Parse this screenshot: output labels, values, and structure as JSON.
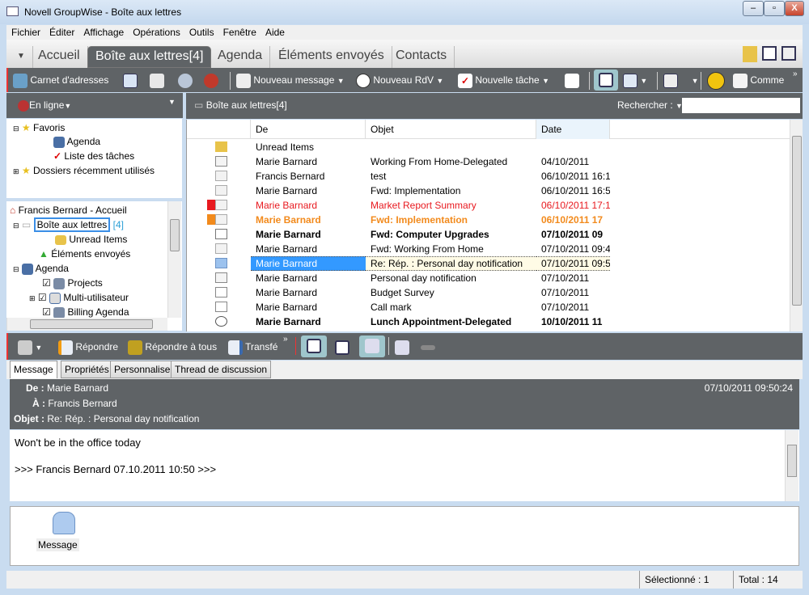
{
  "window": {
    "title": "Novell GroupWise - Boîte aux lettres",
    "minimize": "–",
    "maximize": "▫",
    "close": "X"
  },
  "menu": [
    "Fichier",
    "Éditer",
    "Affichage",
    "Opérations",
    "Outils",
    "Fenêtre",
    "Aide"
  ],
  "tabs": [
    {
      "label": "Accueil"
    },
    {
      "label": "Boîte aux lettres[4]",
      "active": true
    },
    {
      "label": "Agenda"
    },
    {
      "label": "Éléments envoyés"
    },
    {
      "label": "Contacts"
    }
  ],
  "toolbar": {
    "address_book": "Carnet d'adresses",
    "new_message": "Nouveau message",
    "new_appointment": "Nouveau RdV",
    "new_task": "Nouvelle tâche",
    "comment": "Comme",
    "overflow": "»"
  },
  "left": {
    "mode": "En ligne",
    "favorites": [
      {
        "label": "Favoris"
      },
      {
        "label": "Agenda"
      },
      {
        "label": "Liste des tâches"
      },
      {
        "label": "Dossiers récemment utilisés"
      }
    ],
    "tree": {
      "home": "Francis Bernard - Accueil",
      "mailbox": "Boîte aux lettres",
      "mailbox_count": "[4]",
      "unread": "Unread Items",
      "sent": "Éléments envoyés",
      "calendar": "Agenda",
      "projects": "Projects",
      "multi": "Multi-utilisateur",
      "billing": "Billing Agenda"
    }
  },
  "list": {
    "folder": "Boîte aux lettres[4]",
    "search_label": "Rechercher :",
    "search_value": "",
    "columns": [
      "De",
      "Objet",
      "Date"
    ],
    "rows": [
      {
        "icon": "search-folder",
        "from": "Unread Items",
        "subject": "",
        "date": "",
        "style": "normal"
      },
      {
        "icon": "note-attach",
        "from": "Marie Barnard",
        "subject": "Working From Home-Delegated",
        "date": "04/10/2011",
        "style": "normal"
      },
      {
        "icon": "envelope-open",
        "from": "Francis Bernard",
        "subject": "test",
        "date": "06/10/2011 16:1",
        "style": "normal"
      },
      {
        "icon": "envelope-open",
        "from": "Marie Barnard",
        "subject": "Fwd: Implementation",
        "date": "06/10/2011 16:5",
        "style": "normal"
      },
      {
        "icon": "envelope-red-attach",
        "from": "Marie Barnard",
        "subject": "Market Report Summary",
        "date": "06/10/2011 17:1",
        "style": "red"
      },
      {
        "icon": "envelope-orange",
        "from": "Marie Barnard",
        "subject": "Fwd: Implementation",
        "date": "06/10/2011 17",
        "style": "orange"
      },
      {
        "icon": "envelope-attach",
        "from": "Marie Barnard",
        "subject": "Fwd: Computer Upgrades",
        "date": "07/10/2011 09",
        "style": "bold"
      },
      {
        "icon": "envelope-open",
        "from": "Marie Barnard",
        "subject": "Fwd: Working From Home",
        "date": "07/10/2011 09:4",
        "style": "normal"
      },
      {
        "icon": "envelope-blue",
        "from": "Marie Barnard",
        "subject": "Re: Rép. : Personal day notification",
        "date": "07/10/2011 09:5",
        "style": "selected"
      },
      {
        "icon": "note-reply",
        "from": "Marie Barnard",
        "subject": "Personal day notification",
        "date": "07/10/2011",
        "style": "normal"
      },
      {
        "icon": "task",
        "from": "Marie Barnard",
        "subject": "Budget Survey",
        "date": "07/10/2011",
        "style": "normal"
      },
      {
        "icon": "task",
        "from": "Marie Barnard",
        "subject": "Call mark",
        "date": "07/10/2011",
        "style": "normal"
      },
      {
        "icon": "clock-attach",
        "from": "Marie Barnard",
        "subject": "Lunch Appointment-Delegated",
        "date": "10/10/2011 11",
        "style": "bold"
      }
    ]
  },
  "preview_toolbar": {
    "reply": "Répondre",
    "reply_all": "Répondre à tous",
    "forward": "Transfé",
    "overflow": "»"
  },
  "preview": {
    "tabs": [
      "Message",
      "Propriétés",
      "Personnaliser",
      "Thread de discussion"
    ],
    "from_label": "De :",
    "from": "Marie Barnard",
    "to_label": "À :",
    "to": "Francis Bernard",
    "subject_label": "Objet :",
    "subject": "Re: Rép. : Personal day notification",
    "date": "07/10/2011 09:50:24",
    "body": [
      "Won't be in the office today",
      "",
      ">>> Francis Bernard 07.10.2011 10:50 >>>"
    ],
    "attachment": "Message"
  },
  "status": {
    "selected": "Sélectionné : 1",
    "total": "Total : 14"
  },
  "colors": {
    "dark": "#5f6366",
    "red": "#e8191f",
    "orange": "#f28a1c",
    "selected": "#3399ff",
    "count": "#2a9fd6"
  }
}
